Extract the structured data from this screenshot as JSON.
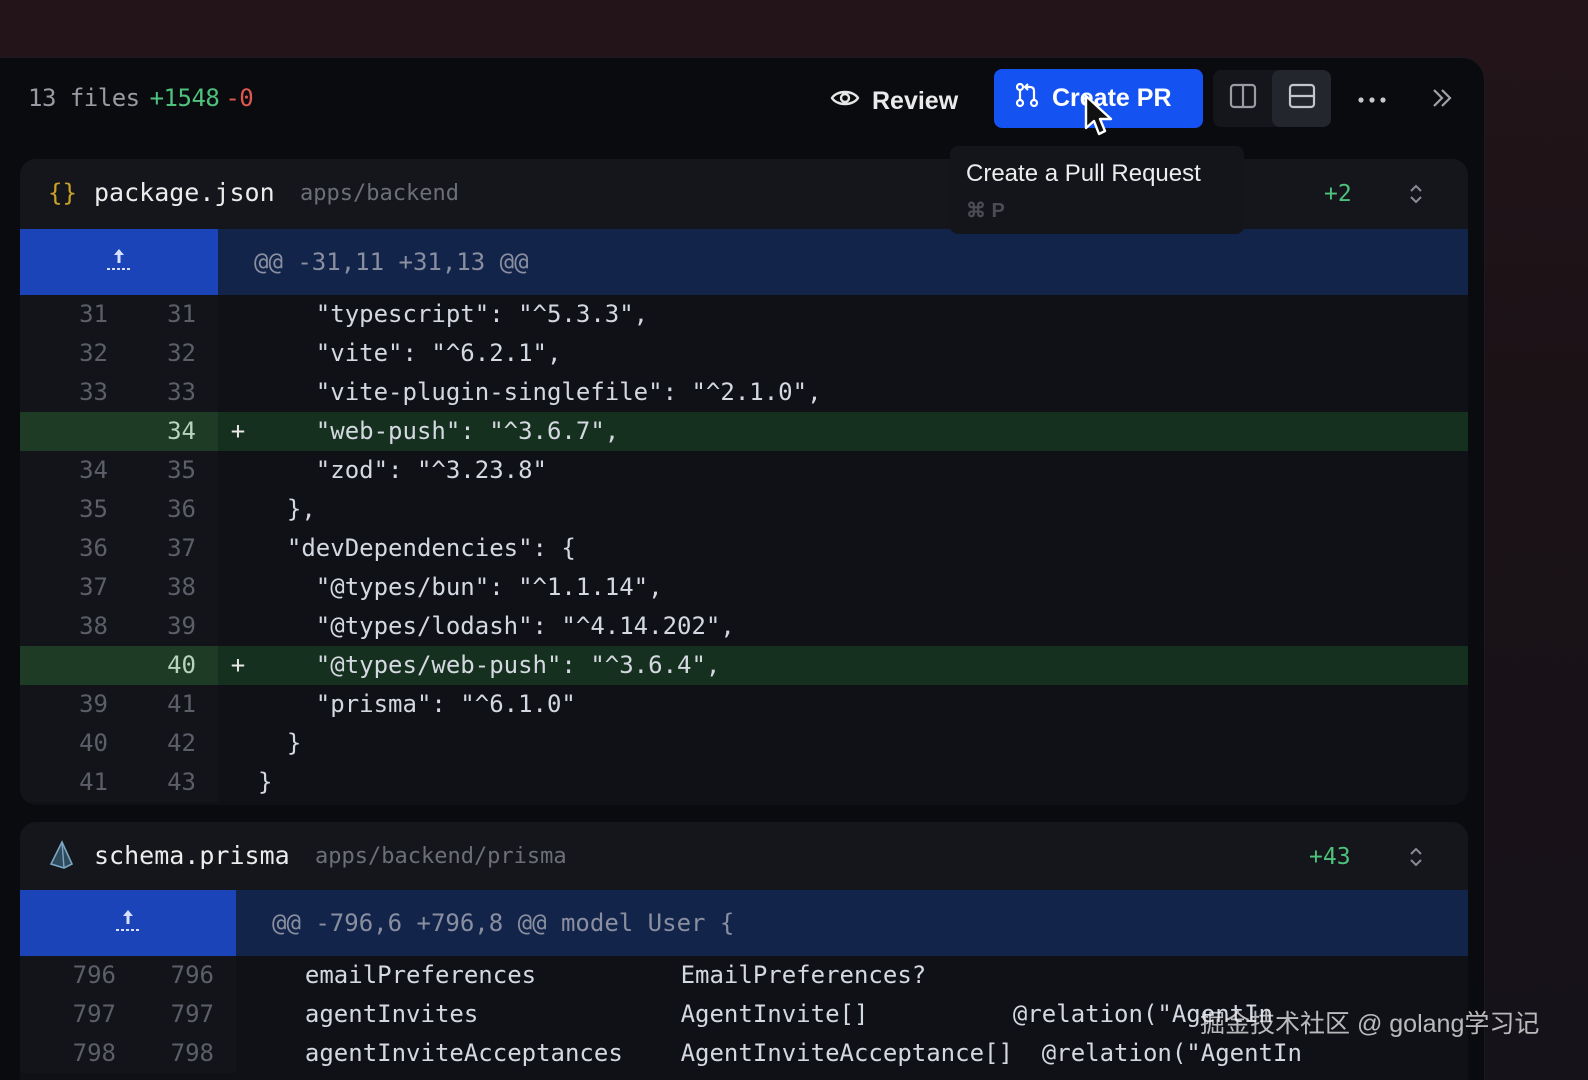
{
  "toolbar": {
    "files_count": "13 files",
    "additions": "+1548",
    "deletions": "-0",
    "review_label": "Review",
    "create_pr_label": "Create PR"
  },
  "tooltip": {
    "title": "Create a Pull Request",
    "shortcut": "⌘ P"
  },
  "files": [
    {
      "icon": "{}",
      "name": "package.json",
      "path": "apps/backend",
      "additions": "+2",
      "hunk": "@@ -31,11 +31,13 @@",
      "lines": [
        {
          "old": "31",
          "new": "31",
          "sign": "",
          "code": "    \"typescript\": \"^5.3.3\","
        },
        {
          "old": "32",
          "new": "32",
          "sign": "",
          "code": "    \"vite\": \"^6.2.1\","
        },
        {
          "old": "33",
          "new": "33",
          "sign": "",
          "code": "    \"vite-plugin-singlefile\": \"^2.1.0\","
        },
        {
          "old": "",
          "new": "34",
          "sign": "+",
          "code": "    \"web-push\": \"^3.6.7\","
        },
        {
          "old": "34",
          "new": "35",
          "sign": "",
          "code": "    \"zod\": \"^3.23.8\""
        },
        {
          "old": "35",
          "new": "36",
          "sign": "",
          "code": "  },"
        },
        {
          "old": "36",
          "new": "37",
          "sign": "",
          "code": "  \"devDependencies\": {"
        },
        {
          "old": "37",
          "new": "38",
          "sign": "",
          "code": "    \"@types/bun\": \"^1.1.14\","
        },
        {
          "old": "38",
          "new": "39",
          "sign": "",
          "code": "    \"@types/lodash\": \"^4.14.202\","
        },
        {
          "old": "",
          "new": "40",
          "sign": "+",
          "code": "    \"@types/web-push\": \"^3.6.4\","
        },
        {
          "old": "39",
          "new": "41",
          "sign": "",
          "code": "    \"prisma\": \"^6.1.0\""
        },
        {
          "old": "40",
          "new": "42",
          "sign": "",
          "code": "  }"
        },
        {
          "old": "41",
          "new": "43",
          "sign": "",
          "code": "}"
        }
      ]
    },
    {
      "icon": "prisma-icon",
      "name": "schema.prisma",
      "path": "apps/backend/prisma",
      "additions": "+43",
      "hunk": "@@ -796,6 +796,8 @@ model User {",
      "lines": [
        {
          "old": "796",
          "new": "796",
          "sign": "",
          "code": "  emailPreferences          EmailPreferences?"
        },
        {
          "old": "797",
          "new": "797",
          "sign": "",
          "code": "  agentInvites              AgentInvite[]          @relation(\"AgentIn"
        },
        {
          "old": "798",
          "new": "798",
          "sign": "",
          "code": "  agentInviteAcceptances    AgentInviteAcceptance[]  @relation(\"AgentIn"
        }
      ]
    }
  ],
  "watermark": "掘金技术社区 @ golang学习记"
}
